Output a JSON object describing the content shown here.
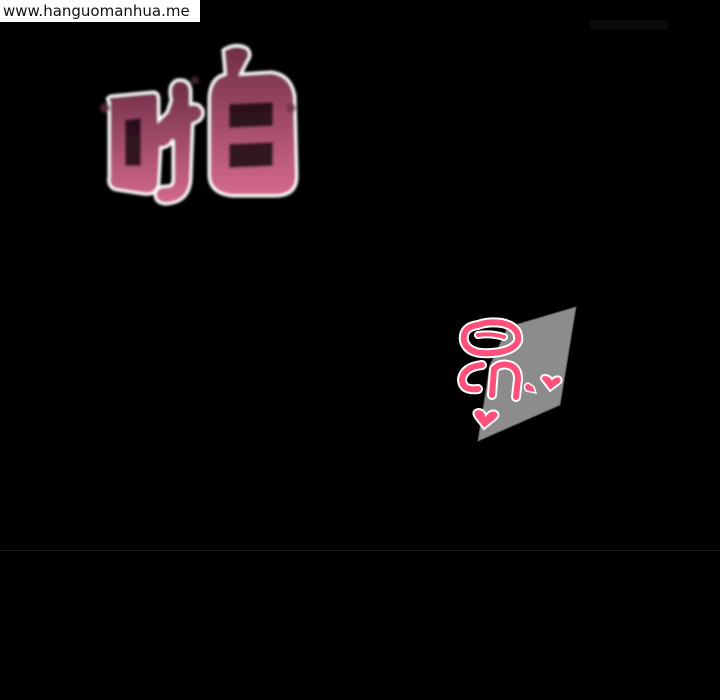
{
  "watermark": {
    "text": "www.hanguomanhua.me"
  },
  "sfx_large": {
    "icon": "sound-effect-pa-icon",
    "fill_top": "#7b3550",
    "fill_bottom": "#d86a8d",
    "outline": "#ffffff"
  },
  "sfx_small": {
    "icon": "sound-effect-moan-icon",
    "fill": "#ff4f7b",
    "backdrop": "#8a8a8a",
    "outline": "#ffffff"
  }
}
